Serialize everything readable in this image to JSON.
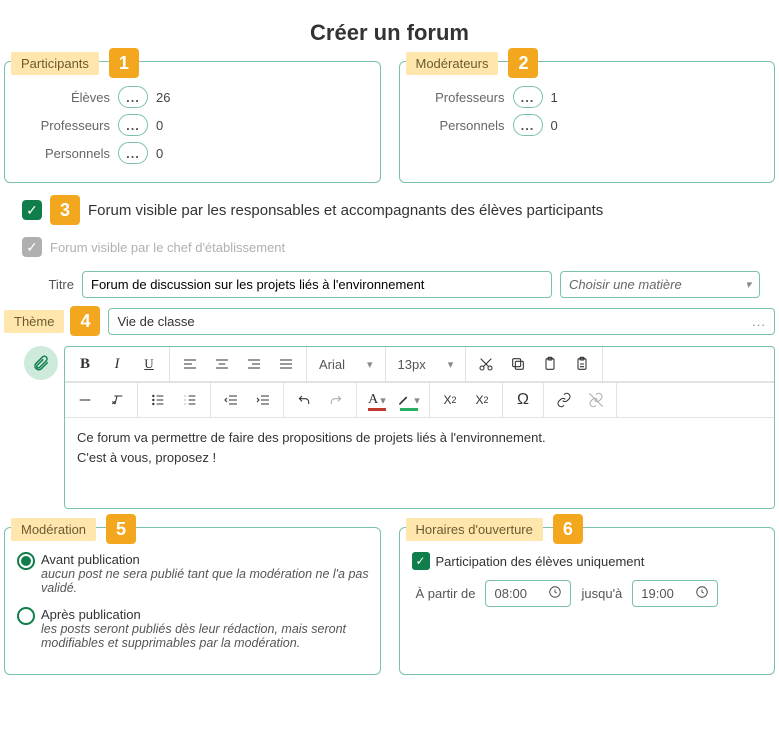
{
  "title": "Créer un forum",
  "participants": {
    "label": "Participants",
    "badge": "1",
    "dots": "...",
    "lines": {
      "eleves": {
        "label": "Élèves",
        "count": "26"
      },
      "profs": {
        "label": "Professeurs",
        "count": "0"
      },
      "perso": {
        "label": "Personnels",
        "count": "0"
      }
    }
  },
  "moderators": {
    "label": "Modérateurs",
    "badge": "2",
    "lines": {
      "profs": {
        "label": "Professeurs",
        "count": "1"
      },
      "perso": {
        "label": "Personnels",
        "count": "0"
      }
    }
  },
  "checks": {
    "responsables": {
      "badge": "3",
      "label": "Forum visible par les responsables et accompagnants des élèves participants"
    },
    "chef": {
      "label": "Forum visible par le chef d'établissement"
    }
  },
  "titre": {
    "label": "Titre",
    "value": "Forum de discussion sur les projets liés à l'environnement",
    "subject_placeholder": "Choisir une matière"
  },
  "theme": {
    "label": "Thème",
    "badge": "4",
    "value": "Vie de classe",
    "dots": "..."
  },
  "editor": {
    "font": "Arial",
    "size": "13px",
    "line1": "Ce forum va permettre de faire des propositions de projets liés à l'environnement.",
    "line2": "C'est à vous, proposez !"
  },
  "moderation": {
    "label": "Modération",
    "badge": "5",
    "avant": {
      "title": "Avant publication",
      "hint": "aucun post ne sera publié tant que la modération ne l'a pas validé."
    },
    "apres": {
      "title": "Après publication",
      "hint": "les posts seront publiés dès leur rédaction, mais seront modifiables et supprimables par la modération."
    }
  },
  "horaires": {
    "label": "Horaires d'ouverture",
    "badge": "6",
    "check_label": "Participation des élèves uniquement",
    "from_label": "À partir de",
    "from": "08:00",
    "to_label": "jusqu'à",
    "to": "19:00"
  }
}
